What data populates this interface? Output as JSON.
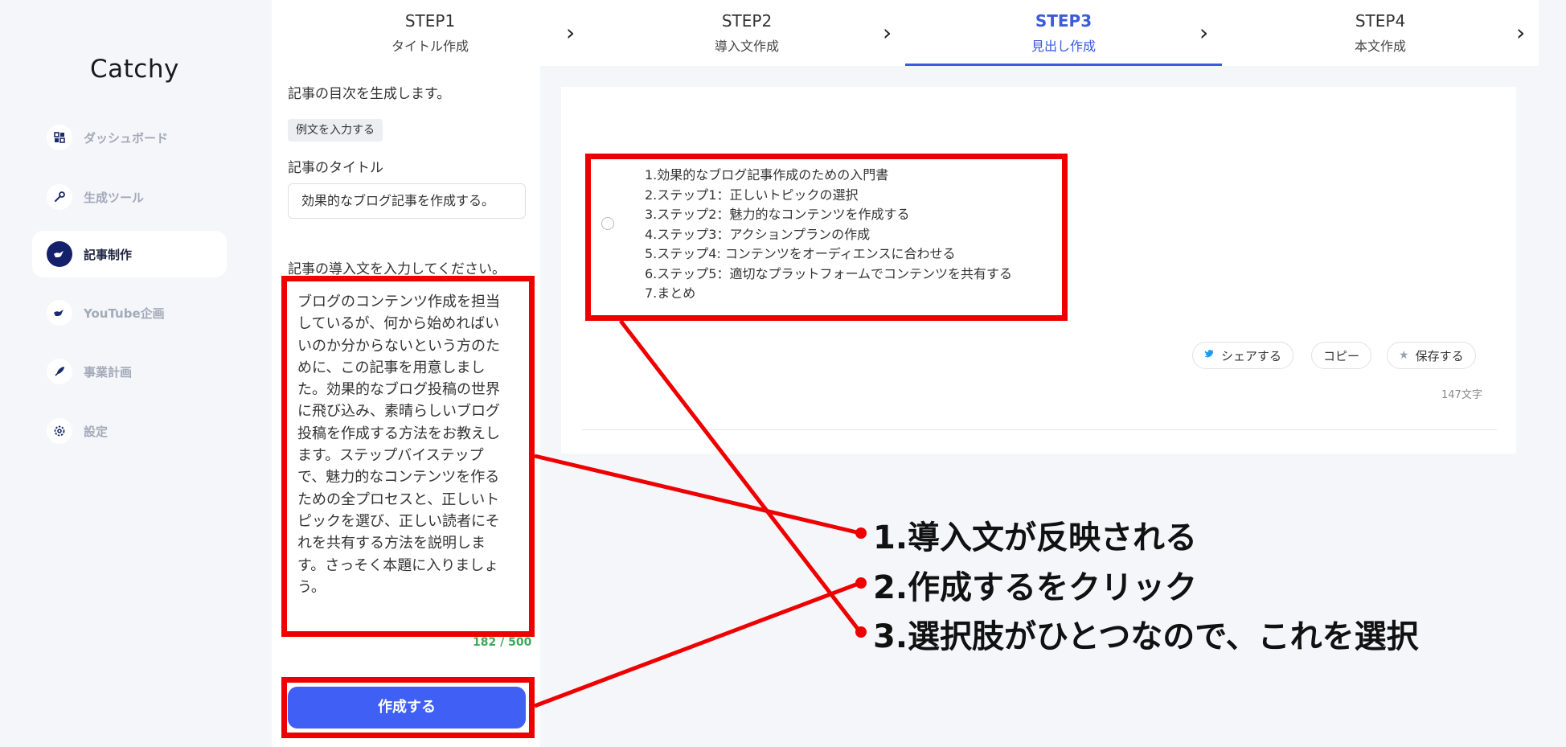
{
  "app": {
    "logo": "Catchy"
  },
  "sidebar": {
    "items": [
      {
        "label": "ダッシュボード",
        "icon": "dashboard-grid-icon",
        "active": false
      },
      {
        "label": "生成ツール",
        "icon": "wrench-icon",
        "active": false
      },
      {
        "label": "記事制作",
        "icon": "genie-lamp-icon",
        "active": true
      },
      {
        "label": "YouTube企画",
        "icon": "genie-lamp-icon",
        "active": false
      },
      {
        "label": "事業計画",
        "icon": "rocket-icon",
        "active": false
      },
      {
        "label": "設定",
        "icon": "gear-icon",
        "active": false
      }
    ]
  },
  "steps": [
    {
      "num": "STEP1",
      "label": "タイトル作成"
    },
    {
      "num": "STEP2",
      "label": "導入文作成"
    },
    {
      "num": "STEP3",
      "label": "見出し作成",
      "active": true
    },
    {
      "num": "STEP4",
      "label": "本文作成"
    }
  ],
  "form": {
    "heading": "記事の目次を生成します。",
    "example_button": "例文を入力する",
    "title_label": "記事のタイトル",
    "title_value": "効果的なブログ記事を作成する。",
    "intro_label": "記事の導入文を入力してください。",
    "intro_value": "ブログのコンテンツ作成を担当しているが、何から始めればいいのか分からないという方のために、この記事を用意しました。効果的なブログ投稿の世界に飛び込み、素晴らしいブログ投稿を作成する方法をお教えします。ステップバイステップで、魅力的なコンテンツを作るための全プロセスと、正しいトピックを選び、正しい読者にそれを共有する方法を説明します。さっそく本題に入りましょう。",
    "counter": "182 / 500",
    "create_button": "作成する"
  },
  "result": {
    "outline": [
      "1.効果的なブログ記事作成のための入門書",
      "2.ステップ1：正しいトピックの選択",
      "3.ステップ2：魅力的なコンテンツを作成する",
      "4.ステップ3：アクションプランの作成",
      "5.ステップ4: コンテンツをオーディエンスに合わせる",
      "6.ステップ5：適切なプラットフォームでコンテンツを共有する",
      "7.まとめ"
    ],
    "share_label": "シェアする",
    "copy_label": "コピー",
    "save_label": "保存する",
    "char_count": "147文字"
  },
  "annotations": [
    "1.導入文が反映される",
    "2.作成するをクリック",
    "3.選択肢がひとつなので、これを選択"
  ],
  "colors": {
    "accent": "#3f5ff5",
    "annotation_red": "#ee0000",
    "counter_green": "#3aaa5c",
    "sidebar_active": "#14206a"
  }
}
